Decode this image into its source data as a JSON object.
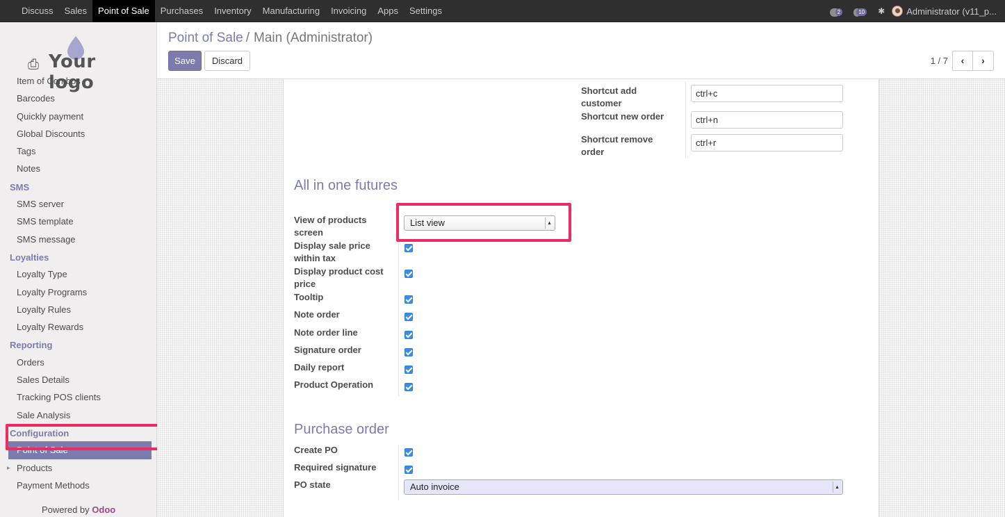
{
  "topbar": {
    "menu": [
      "Discuss",
      "Sales",
      "Point of Sale",
      "Purchases",
      "Inventory",
      "Manufacturing",
      "Invoicing",
      "Apps",
      "Settings"
    ],
    "active": "Point of Sale",
    "messages_count": "2",
    "activity_count": "10",
    "user": "Administrator (v11_p..."
  },
  "logo": {
    "text": "Your logo"
  },
  "sidebar": {
    "items": [
      {
        "type": "item",
        "label": "Item of Combos"
      },
      {
        "type": "item",
        "label": "Barcodes"
      },
      {
        "type": "item",
        "label": "Quickly payment"
      },
      {
        "type": "item",
        "label": "Global Discounts"
      },
      {
        "type": "item",
        "label": "Tags"
      },
      {
        "type": "item",
        "label": "Notes"
      },
      {
        "type": "header",
        "label": "SMS"
      },
      {
        "type": "item",
        "label": "SMS server"
      },
      {
        "type": "item",
        "label": "SMS template"
      },
      {
        "type": "item",
        "label": "SMS message"
      },
      {
        "type": "header",
        "label": "Loyalties"
      },
      {
        "type": "item",
        "label": "Loyalty Type"
      },
      {
        "type": "item",
        "label": "Loyalty Programs"
      },
      {
        "type": "item",
        "label": "Loyalty Rules"
      },
      {
        "type": "item",
        "label": "Loyalty Rewards"
      },
      {
        "type": "header",
        "label": "Reporting"
      },
      {
        "type": "item",
        "label": "Orders"
      },
      {
        "type": "item",
        "label": "Sales Details"
      },
      {
        "type": "item",
        "label": "Tracking POS clients"
      },
      {
        "type": "item",
        "label": "Sale Analysis"
      },
      {
        "type": "header",
        "label": "Configuration"
      },
      {
        "type": "item",
        "label": "Point of Sale",
        "selected": true
      },
      {
        "type": "item",
        "label": "Products",
        "caret": true
      },
      {
        "type": "item",
        "label": "Payment Methods"
      }
    ],
    "powered_by": "Powered by",
    "powered_brand": "Odoo"
  },
  "control": {
    "breadcrumb_root": "Point of Sale",
    "breadcrumb_sep": "/",
    "breadcrumb_current": "Main (Administrator)",
    "save_label": "Save",
    "discard_label": "Discard",
    "pager_value": "1 / 7",
    "prev_icon": "chevron-left-icon",
    "next_icon": "chevron-right-icon"
  },
  "form": {
    "shortcuts": {
      "add_customer_label": "Shortcut add customer",
      "add_customer_value": "ctrl+c",
      "new_order_label": "Shortcut new order",
      "new_order_value": "ctrl+n",
      "remove_order_label": "Shortcut remove order",
      "remove_order_value": "ctrl+r"
    },
    "all_in_one": {
      "title": "All in one futures",
      "view_label": "View of products screen",
      "view_value": "List view",
      "fields": [
        {
          "label": "Display sale price within tax",
          "checked": true
        },
        {
          "label": "Display product cost price",
          "checked": true
        },
        {
          "label": "Tooltip",
          "checked": true
        },
        {
          "label": "Note order",
          "checked": true
        },
        {
          "label": "Note order line",
          "checked": true
        },
        {
          "label": "Signature order",
          "checked": true
        },
        {
          "label": "Daily report",
          "checked": true
        },
        {
          "label": "Product Operation",
          "checked": true
        }
      ]
    },
    "purchase": {
      "title": "Purchase order",
      "create_po_label": "Create PO",
      "create_po_checked": true,
      "required_signature_label": "Required signature",
      "required_signature_checked": true,
      "po_state_label": "PO state",
      "po_state_value": "Auto invoice"
    }
  },
  "colors": {
    "accent": "#7c7bad",
    "highlight": "#ee2a63",
    "checkbox": "#3b8ee8",
    "topbar": "#2f2f2f"
  }
}
